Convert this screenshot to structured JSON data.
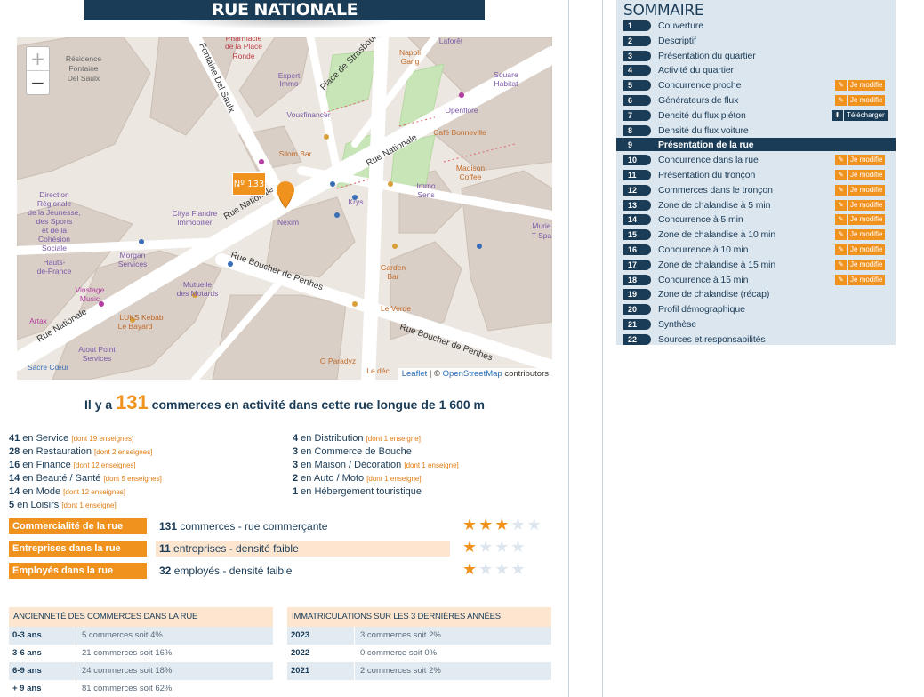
{
  "title": "RUE NATIONALE",
  "map": {
    "zoom_in": "+",
    "zoom_out": "−",
    "marker_label": "Nº 133",
    "attribution_leaflet": "Leaflet",
    "attribution_sep": " | © ",
    "attribution_osm": "OpenStreetMap",
    "attribution_tail": " contributors",
    "street_labels": [
      "Rue Nationale",
      "Rue Nationale",
      "Rue Nationale",
      "Rue Boucher de Perthes",
      "Rue Boucher de Perthes",
      "Place de Strasbourg",
      "Fontaine Del Saulx"
    ],
    "place_labels": [
      "Résidence",
      "Fontaine",
      "Del Saulx",
      "Pharmacie",
      "de la Place",
      "Ronde",
      "Expert",
      "Immo",
      "Napoli",
      "Gang",
      "Laforêt",
      "Square",
      "Habitat",
      "Openflore",
      "Café Bonneville",
      "Vousfinancer",
      "Silom Bar",
      "Madison",
      "Coffee",
      "Immo",
      "Sens",
      "Krys",
      "Direction",
      "Régionale",
      "de la Jeunesse,",
      "des Sports",
      "et de la",
      "Cohésion",
      "Sociale",
      "Hauts-",
      "de-France",
      "Citya Flandre",
      "Immobilier",
      "Néxim",
      "Morgan",
      "Services",
      "Mutuelle",
      "des Motards",
      "Garden",
      "Bar",
      "Vinstage",
      "Music",
      "LUKS Kebab",
      "Le Bayard",
      "Artax",
      "Atout Point",
      "Services",
      "Le Verde",
      "O Paradyz",
      "Le déc",
      "Sacré Cœur",
      "Murie",
      "T Spa"
    ]
  },
  "headline": {
    "prefix": "Il y a ",
    "count": "131",
    "suffix": " commerces en activité dans cette rue longue de 1 600 m"
  },
  "categories_left": [
    {
      "n": "41",
      "label": " en Service ",
      "enseignes": "[dont 19 enseignes]"
    },
    {
      "n": "28",
      "label": " en Restauration ",
      "enseignes": "[dont 2 enseignes]"
    },
    {
      "n": "16",
      "label": " en Finance ",
      "enseignes": "[dont 12 enseignes]"
    },
    {
      "n": "14",
      "label": " en Beauté / Santé ",
      "enseignes": "[dont 5 enseignes]"
    },
    {
      "n": "14",
      "label": " en Mode ",
      "enseignes": "[dont 12 enseignes]"
    },
    {
      "n": "5",
      "label": " en Loisirs ",
      "enseignes": "[dont 1 enseigne]"
    }
  ],
  "categories_right": [
    {
      "n": "4",
      "label": " en Distribution ",
      "enseignes": "[dont 1 enseigne]"
    },
    {
      "n": "3",
      "label": " en Commerce de Bouche",
      "enseignes": ""
    },
    {
      "n": "3",
      "label": " en Maison / Décoration ",
      "enseignes": "[dont 1 enseigne]"
    },
    {
      "n": "2",
      "label": " en Auto / Moto ",
      "enseignes": "[dont 1 enseigne]"
    },
    {
      "n": "1",
      "label": " en Hébergement touristique",
      "enseignes": ""
    }
  ],
  "ratings": [
    {
      "label": "Commercialité de la rue",
      "value": "131",
      "text": " commerces - rue commerçante",
      "stars": 3,
      "max": 5
    },
    {
      "label": "Entreprises dans la rue",
      "value": "11",
      "text": " entreprises - densité faible",
      "stars": 1,
      "max": 4
    },
    {
      "label": "Employés dans la rue",
      "value": "32",
      "text": " employés - densité faible",
      "stars": 1,
      "max": 4
    }
  ],
  "star_glyph": "★",
  "anciennete": {
    "header": "ANCIENNETÉ DES COMMERCES DANS LA RUE",
    "rows": [
      {
        "k": "0-3 ans",
        "v": "5 commerces soit 4%"
      },
      {
        "k": "3-6 ans",
        "v": "21 commerces soit 16%"
      },
      {
        "k": "6-9 ans",
        "v": "24 commerces soit 18%"
      },
      {
        "k": "+ 9 ans",
        "v": "81 commerces soit 62%"
      }
    ]
  },
  "immatriculations": {
    "header": "IMMATRICULATIONS SUR LES 3 DERNIÈRES ANNÉES",
    "rows": [
      {
        "k": "2023",
        "v": "3 commerces soit 2%"
      },
      {
        "k": "2022",
        "v": "0 commerce soit 0%"
      },
      {
        "k": "2021",
        "v": "2 commerces soit 2%"
      }
    ]
  },
  "sommaire": {
    "title": "SOMMAIRE",
    "modify_label": "Je modifie",
    "download_label": "Télécharger",
    "items": [
      {
        "num": "1",
        "label": "Couverture",
        "action": ""
      },
      {
        "num": "2",
        "label": "Descriptif",
        "action": ""
      },
      {
        "num": "3",
        "label": "Présentation du quartier",
        "action": ""
      },
      {
        "num": "4",
        "label": "Activité du quartier",
        "action": ""
      },
      {
        "num": "5",
        "label": "Concurrence proche",
        "action": "modify"
      },
      {
        "num": "6",
        "label": "Générateurs de flux",
        "action": "modify"
      },
      {
        "num": "7",
        "label": "Densité du flux piéton",
        "action": "download"
      },
      {
        "num": "8",
        "label": "Densité du flux voiture",
        "action": ""
      },
      {
        "num": "9",
        "label": "Présentation de la rue",
        "action": "",
        "active": true
      },
      {
        "num": "10",
        "label": "Concurrence dans la rue",
        "action": "modify"
      },
      {
        "num": "11",
        "label": "Présentation du tronçon",
        "action": "modify"
      },
      {
        "num": "12",
        "label": "Commerces dans le tronçon",
        "action": "modify"
      },
      {
        "num": "13",
        "label": "Zone de chalandise à 5 min",
        "action": "modify"
      },
      {
        "num": "14",
        "label": "Concurrence à 5 min",
        "action": "modify"
      },
      {
        "num": "15",
        "label": "Zone de chalandise à 10 min",
        "action": "modify"
      },
      {
        "num": "16",
        "label": "Concurrence à 10 min",
        "action": "modify"
      },
      {
        "num": "17",
        "label": "Zone de chalandise à 15 min",
        "action": "modify"
      },
      {
        "num": "18",
        "label": "Concurrence à 15 min",
        "action": "modify"
      },
      {
        "num": "19",
        "label": "Zone de chalandise (récap)",
        "action": ""
      },
      {
        "num": "20",
        "label": "Profil démographique",
        "action": ""
      },
      {
        "num": "21",
        "label": "Synthèse",
        "action": ""
      },
      {
        "num": "22",
        "label": "Sources et responsabilités",
        "action": ""
      }
    ]
  },
  "colors": {
    "navy": "#1b3c57",
    "orange": "#f0921e",
    "light_blue": "#dce6ef",
    "peach": "#fde6d0"
  }
}
